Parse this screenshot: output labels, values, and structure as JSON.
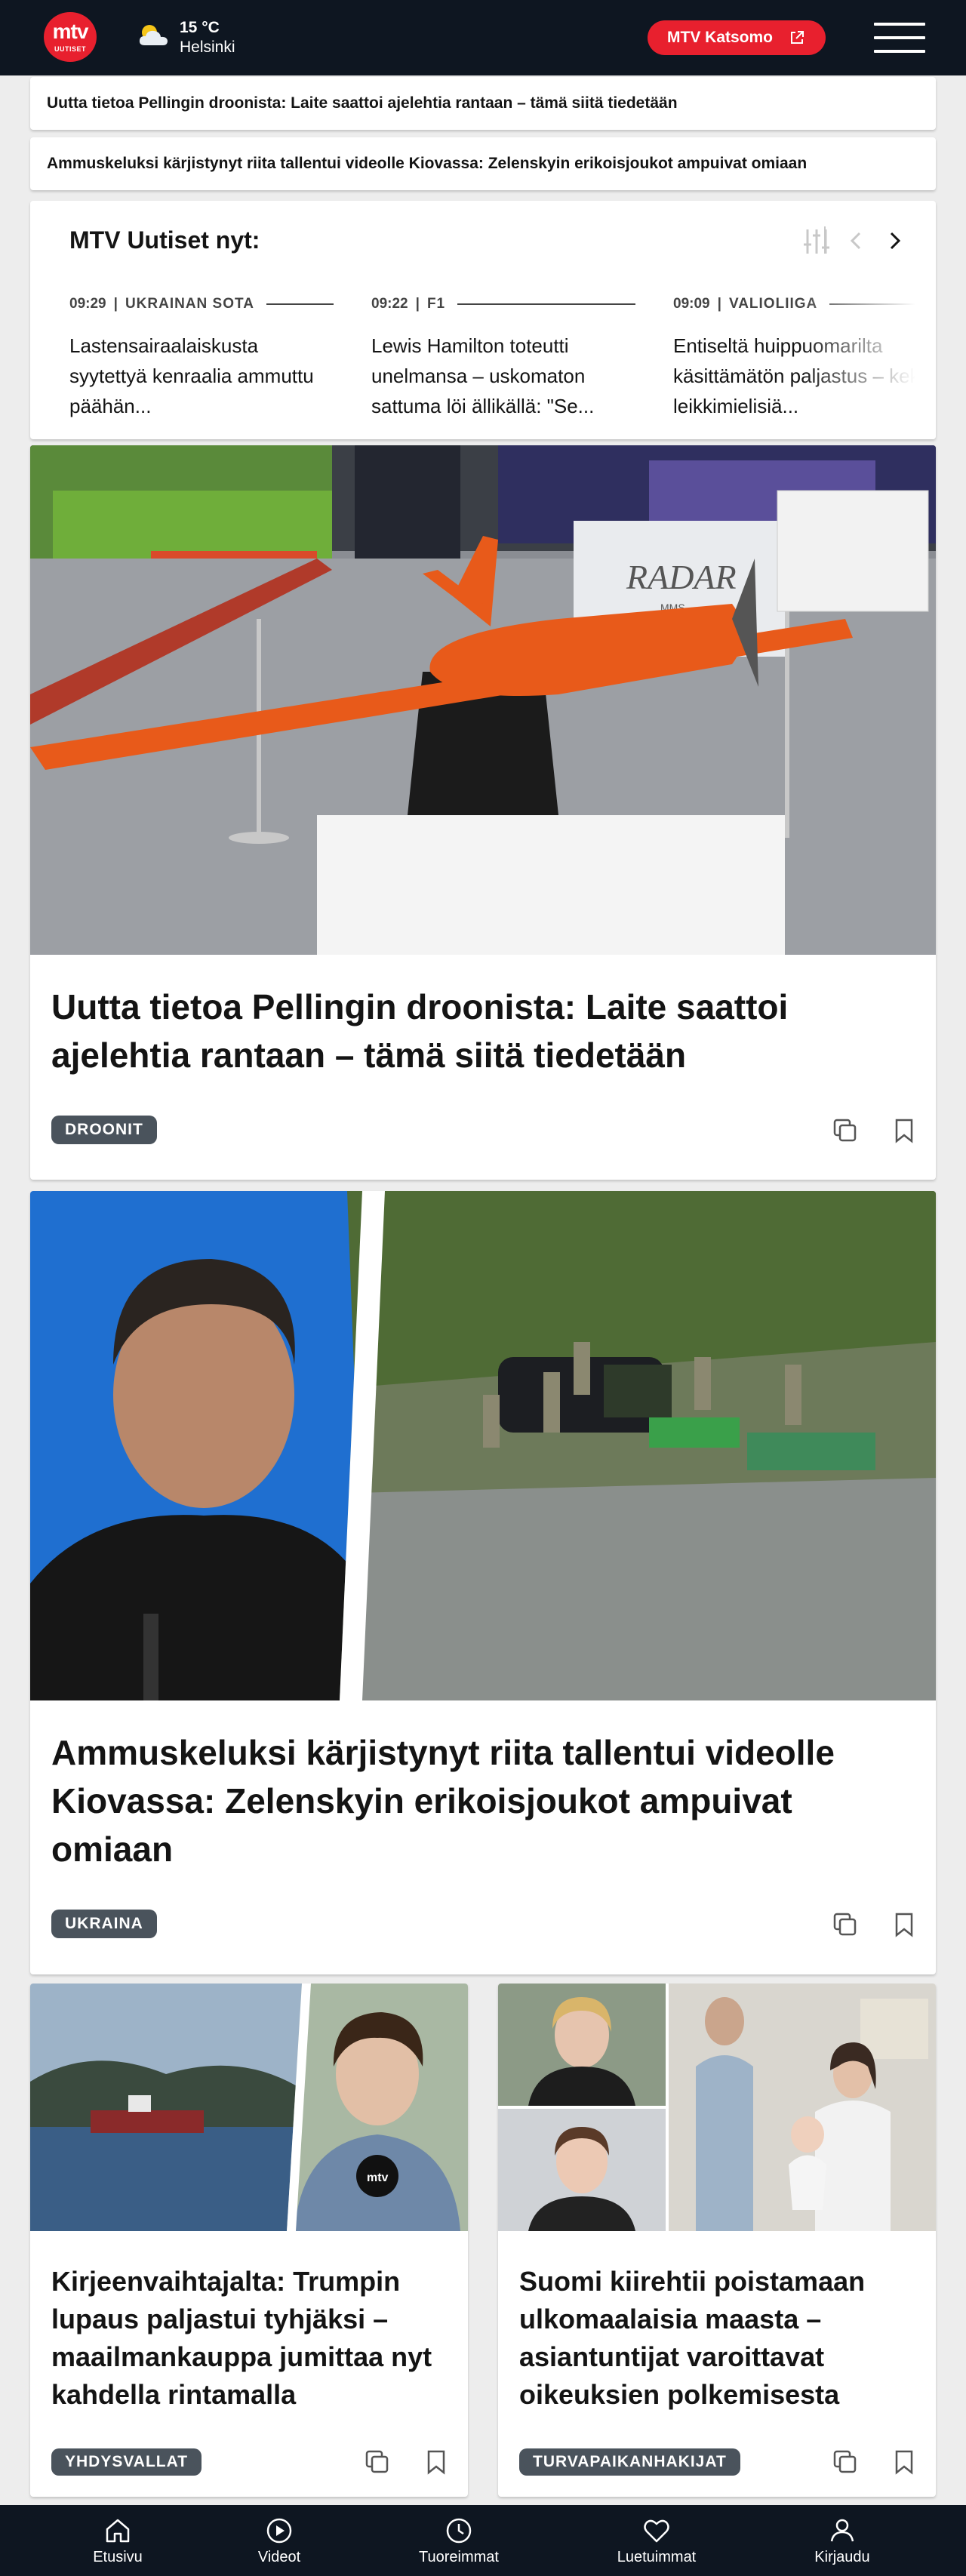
{
  "header": {
    "logo_text": "mtv",
    "logo_sub": "UUTISET",
    "weather_temp": "15 °C",
    "weather_city": "Helsinki",
    "katsomo_label": "MTV Katsomo"
  },
  "breaking": [
    "Uutta tietoa Pellingin droonista: Laite saattoi ajelehtia rantaan – tämä siitä tiedetään",
    "Ammuskeluksi kärjistynyt riita tallentui videolle Kiovassa: Zelenskyin erikoisjoukot ampuivat omiaan"
  ],
  "now_news": {
    "title": "MTV Uutiset nyt:",
    "items": [
      {
        "time": "09:29",
        "category": "UKRAINAN SOTA",
        "text": "Lastensairaalaiskusta syytettyä kenraalia ammuttu päähän..."
      },
      {
        "time": "09:22",
        "category": "F1",
        "text": "Lewis Hamilton toteutti unelmansa – uskomaton sattuma löi ällikällä: \"Se..."
      },
      {
        "time": "09:09",
        "category": "VALIOLIIGA",
        "text": "Entiseltä huippuomarilta käsittämätön paljastus – keksi leikkimielisiä..."
      }
    ]
  },
  "articles": [
    {
      "headline": "Uutta tietoa Pellingin droonista: Laite saattoi ajelehtia rantaan – tämä siitä tiedetään",
      "tag": "DROONIT",
      "image_text": "RADAR",
      "image_subtext": "MMS"
    },
    {
      "headline": "Ammuskeluksi kärjistynyt riita tallentui videolle Kiovassa: Zelenskyin erikoisjoukot ampuivat omiaan",
      "tag": "UKRAINA"
    },
    {
      "headline": "Kirjeenvaihtajalta: Trumpin lupaus paljastui tyhjäksi – maailmankauppa jumittaa nyt kahdella rintamalla",
      "tag": "YHDYSVALLAT",
      "image_text": "mtv"
    },
    {
      "headline": "Suomi kiirehtii poistamaan ulkomaalaisia maasta – asiantuntijat varoittavat oikeuksien polkemisesta",
      "tag": "TURVAPAIKANHAKIJAT"
    }
  ],
  "bottom_nav": [
    {
      "label": "Etusivu",
      "icon": "home-icon"
    },
    {
      "label": "Videot",
      "icon": "play-icon"
    },
    {
      "label": "Tuoreimmat",
      "icon": "clock-icon"
    },
    {
      "label": "Luetuimmat",
      "icon": "heart-icon"
    },
    {
      "label": "Kirjaudu",
      "icon": "user-icon"
    }
  ],
  "colors": {
    "brand_red": "#e8202e",
    "header_bg": "#0e1621",
    "tag_bg": "#4a535c"
  }
}
